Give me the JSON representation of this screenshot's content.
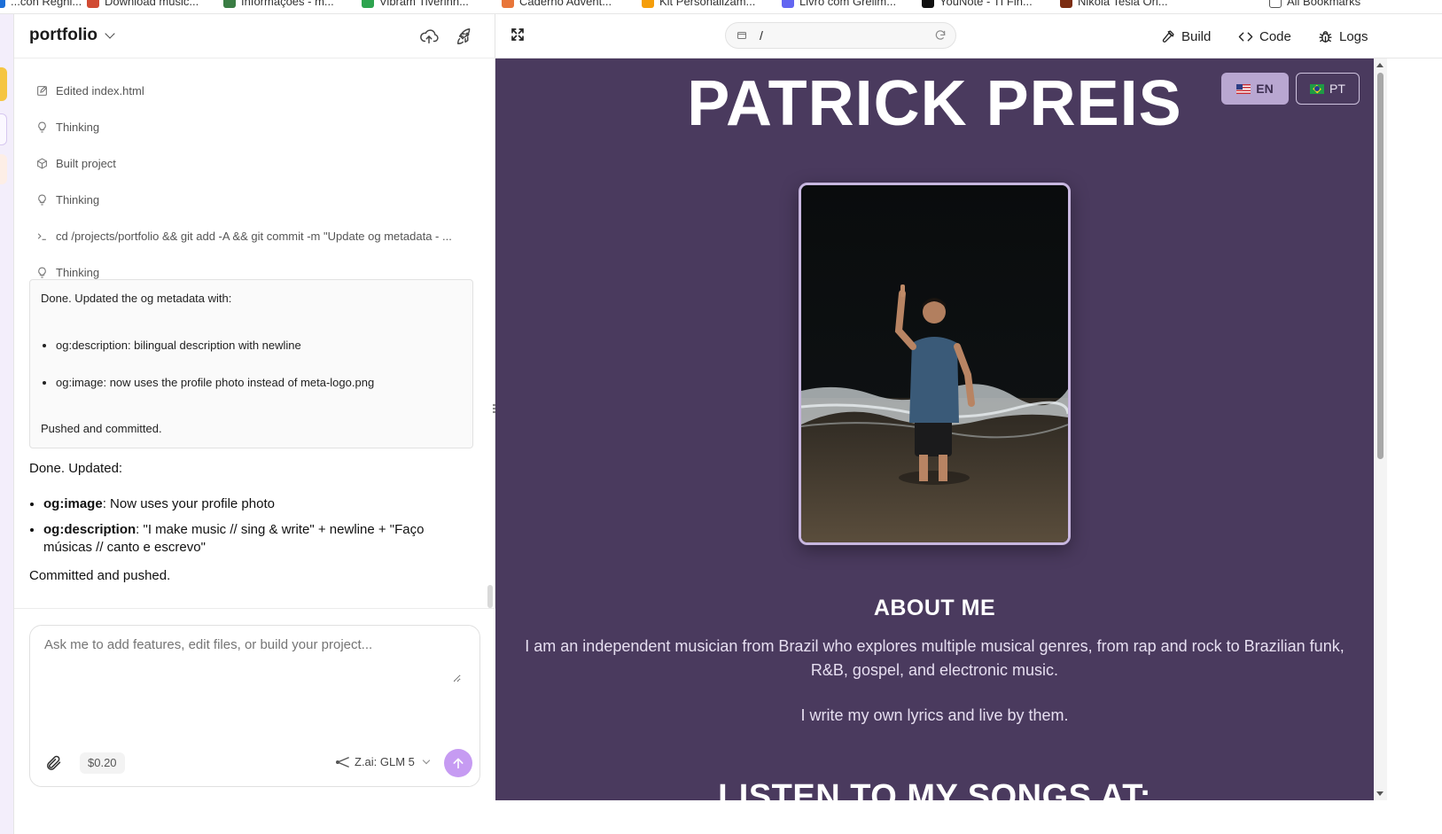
{
  "bookmarks": [
    {
      "label": "...con Regni...",
      "color": "#1d6fd8"
    },
    {
      "label": "Download music...",
      "color": "#d14b33"
    },
    {
      "label": "Informações - m...",
      "color": "#3a7d44"
    },
    {
      "label": "Vibram Tiverinh...",
      "color": "#2ea44f"
    },
    {
      "label": "Caderno Advent...",
      "color": "#e8763a"
    },
    {
      "label": "Kit Personalizam...",
      "color": "#f59e0b"
    },
    {
      "label": "Livro com Grelim...",
      "color": "#6366f1"
    },
    {
      "label": "YouNote - TI Fin...",
      "color": "#111111"
    },
    {
      "label": "Nikola Tesla Ori...",
      "color": "#7c2d12"
    },
    {
      "label": "All Bookmarks",
      "color": "#555555"
    }
  ],
  "chat": {
    "project_title": "portfolio",
    "steps": [
      {
        "icon": "edit-icon",
        "label": "Edited index.html"
      },
      {
        "icon": "lightbulb-icon",
        "label": "Thinking"
      },
      {
        "icon": "package-icon",
        "label": "Built project"
      },
      {
        "icon": "lightbulb-icon",
        "label": "Thinking"
      },
      {
        "icon": "terminal-icon",
        "label": "cd /projects/portfolio && git add -A && git commit -m \"Update og metadata - ..."
      },
      {
        "icon": "lightbulb-icon",
        "label": "Thinking"
      }
    ],
    "done_box": {
      "intro": "Done. Updated the og metadata with:",
      "items": [
        "og:description: bilingual description with newline",
        "og:image: now uses the profile photo instead of meta-logo.png"
      ],
      "outro": "Pushed and committed."
    },
    "reply": {
      "intro": "Done. Updated:",
      "items": [
        {
          "key": "og:image",
          "text": ": Now uses your profile photo"
        },
        {
          "key": "og:description",
          "text": ": \"I make music // sing & write\" + newline + \"Faço músicas // canto e escrevo\""
        }
      ],
      "closing": "Committed and pushed."
    },
    "input": {
      "placeholder": "Ask me to add features, edit files, or build your project...",
      "cost": "$0.20",
      "model": "Z.ai: GLM 5"
    }
  },
  "toolbar": {
    "url": "/",
    "build_label": "Build",
    "code_label": "Code",
    "logs_label": "Logs"
  },
  "preview": {
    "site_title": "PATRICK PREIS",
    "lang_en": "EN",
    "lang_pt": "PT",
    "about_heading": "ABOUT ME",
    "about_text": "I am an independent musician from Brazil who explores multiple musical genres, from rap and rock to Brazilian funk, R&B, gospel, and electronic music.",
    "about_text_2": "I write my own lyrics and live by them.",
    "listen_heading": "LISTEN TO MY SONGS AT:"
  },
  "colors": {
    "preview_bg": "#4a3a5e",
    "accent_purple": "#c69bf2",
    "lang_active_bg": "#b9a7d1"
  }
}
